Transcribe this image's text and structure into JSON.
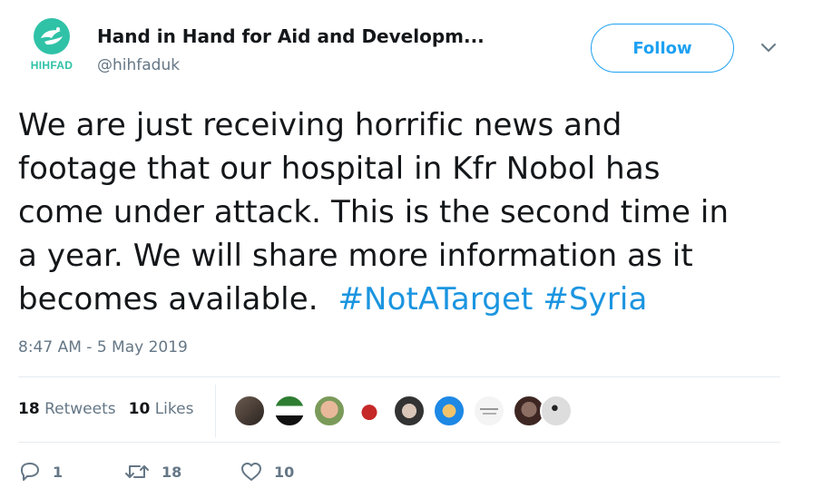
{
  "account": {
    "display_name": "Hand in Hand for Aid and Developm...",
    "handle": "@hihfaduk",
    "logo_text": "HIHFAD",
    "avatar_icon": "dove-hands-icon"
  },
  "follow_label": "Follow",
  "tweet": {
    "line1": "We are just receiving horrific news and",
    "line2": "footage that our hospital in Kfr Nobol has",
    "line3": "come under attack.  This is the second time in",
    "line4": "a year.  We will share more information as it",
    "line5_text": "becomes available.",
    "hashtags": [
      "#NotATarget",
      "#Syria"
    ]
  },
  "timestamp": "8:47 AM - 5 May 2019",
  "stats": {
    "retweets_count": "18",
    "retweets_label": "Retweets",
    "likes_count": "10",
    "likes_label": "Likes"
  },
  "actions": {
    "reply_count": "1",
    "retweet_count": "18",
    "like_count": "10"
  },
  "colors": {
    "brand_teal": "#2fc2a7",
    "link_blue": "#1b95e0",
    "follow_blue": "#1da1f2",
    "muted_gray": "#657786",
    "divider": "#e6ecf0"
  }
}
